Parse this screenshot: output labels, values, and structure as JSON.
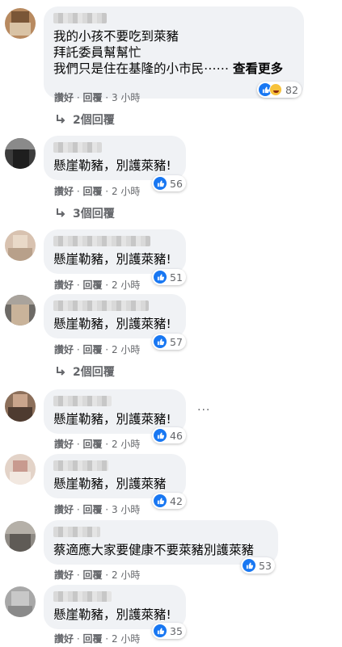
{
  "comments": [
    {
      "text_lines": [
        "我的小孩不要吃到萊豬",
        "拜託委員幫幫忙",
        "我們只是住在基隆的小市民⋯⋯ "
      ],
      "see_more": "查看更多",
      "like": "讚好",
      "reply": "回覆",
      "time": "3 小時",
      "reactions": "82",
      "replies": "2個回覆"
    },
    {
      "text_lines": [
        "懸崖勒豬，別護萊豬!"
      ],
      "like": "讚好",
      "reply": "回覆",
      "time": "2 小時",
      "reactions": "56",
      "replies": "3個回覆"
    },
    {
      "text_lines": [
        "懸崖勒豬，別護萊豬!"
      ],
      "like": "讚好",
      "reply": "回覆",
      "time": "2 小時",
      "reactions": "51"
    },
    {
      "text_lines": [
        "懸崖勒豬，別護萊豬!"
      ],
      "like": "讚好",
      "reply": "回覆",
      "time": "2 小時",
      "reactions": "57",
      "replies": "2個回覆"
    },
    {
      "text_lines": [
        "懸崖勒豬，別護萊豬!"
      ],
      "like": "讚好",
      "reply": "回覆",
      "time": "2 小時",
      "reactions": "46",
      "more": "···"
    },
    {
      "text_lines": [
        "懸崖勒豬，別護萊豬"
      ],
      "like": "讚好",
      "reply": "回覆",
      "time": "3 小時",
      "reactions": "42"
    },
    {
      "text_lines": [
        "蔡適應大家要健康不要萊豬別護萊豬"
      ],
      "like": "讚好",
      "reply": "回覆",
      "time": "2 小時",
      "reactions": "53"
    },
    {
      "text_lines": [
        "懸崖勒豬，別護萊豬!"
      ],
      "like": "讚好",
      "reply": "回覆",
      "time": "2 小時",
      "reactions": "35"
    }
  ],
  "sep": " · ",
  "colors": {
    "like_blue": "#1877f2",
    "bubble": "#f0f2f5",
    "meta_gray": "#65676b"
  },
  "icons": {
    "like": "thumbs-up-icon",
    "haha": "haha-face-icon",
    "reply": "reply-arrow-icon"
  }
}
